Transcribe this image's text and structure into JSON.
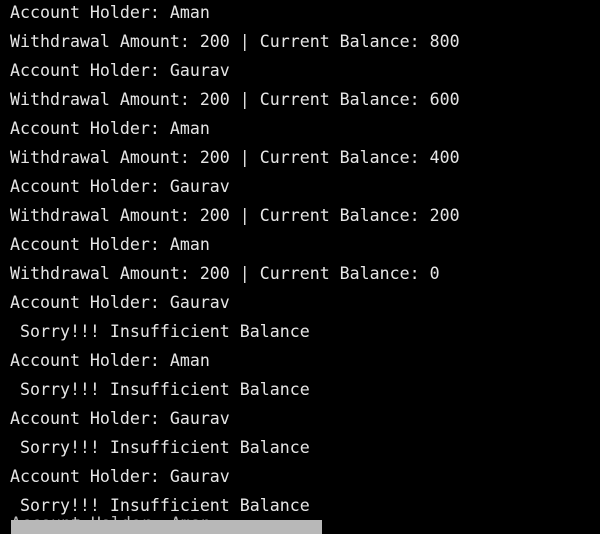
{
  "console": {
    "lines": [
      "Account Holder: Aman",
      "Withdrawal Amount: 200 | Current Balance: 800",
      "Account Holder: Gaurav",
      "Withdrawal Amount: 200 | Current Balance: 600",
      "Account Holder: Aman",
      "Withdrawal Amount: 200 | Current Balance: 400",
      "Account Holder: Gaurav",
      "Withdrawal Amount: 200 | Current Balance: 200",
      "Account Holder: Aman",
      "Withdrawal Amount: 200 | Current Balance: 0",
      "Account Holder: Gaurav",
      " Sorry!!! Insufficient Balance",
      "Account Holder: Aman",
      " Sorry!!! Insufficient Balance",
      "Account Holder: Gaurav",
      " Sorry!!! Insufficient Balance",
      "Account Holder: Gaurav",
      " Sorry!!! Insufficient Balance"
    ],
    "partial_line": "Account Holder: Aman"
  },
  "colors": {
    "background": "#000000",
    "text": "#e6e6e6",
    "selection": "#b8b8b8"
  }
}
